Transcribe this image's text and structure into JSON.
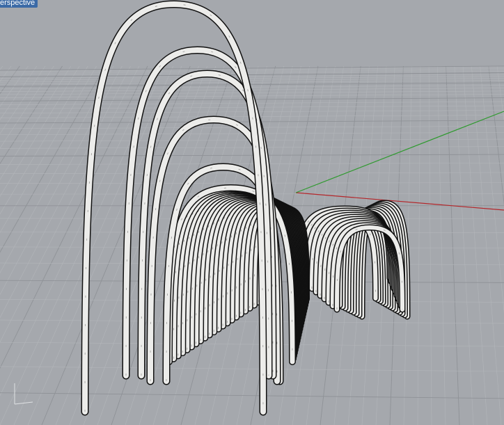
{
  "viewport": {
    "title": "erspective",
    "background": "#a5a8ad",
    "grid": {
      "minor_color": "#b3b6ba",
      "major_color": "#8f9297"
    },
    "axes": {
      "x_color": "#b4262a",
      "y_color": "#2f9a2f",
      "z_color": "#e6e6e6"
    },
    "object": {
      "type": "pipe-arches",
      "fill": "#ececea",
      "stroke": "#111111"
    }
  }
}
